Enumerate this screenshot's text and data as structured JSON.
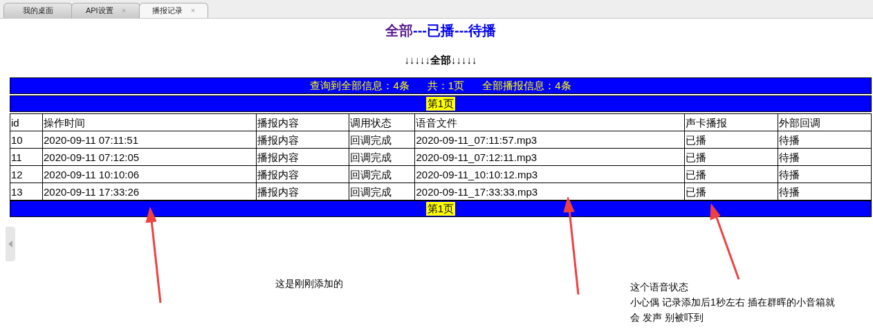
{
  "tabs": [
    {
      "label": "我的桌面",
      "selected": false,
      "closable": false
    },
    {
      "label": "API设置",
      "selected": false,
      "closable": true
    },
    {
      "label": "播报记录",
      "selected": true,
      "closable": true
    }
  ],
  "close_glyph": "×",
  "filter_links": [
    {
      "label": "全部",
      "visited": true
    },
    {
      "label": "已播",
      "visited": false
    },
    {
      "label": "待播",
      "visited": false
    }
  ],
  "separator": "---",
  "current_filter": "↓↓↓↓↓**全部**↓↓↓↓↓",
  "summary": [
    "查询到全部信息：4条",
    "共：1页",
    "全部播报信息：4条"
  ],
  "page_top": "第1页",
  "table": {
    "columns": [
      "id",
      "操作时间",
      "播报内容",
      "调用状态",
      "语音文件",
      "声卡播报",
      "外部回调"
    ],
    "rows": [
      [
        "10",
        "2020-09-11 07:11:51",
        "播报内容",
        "回调完成",
        "2020-09-11_07:11:57.mp3",
        "已播",
        "待播"
      ],
      [
        "11",
        "2020-09-11 07:12:05",
        "播报内容",
        "回调完成",
        "2020-09-11_07:12:11.mp3",
        "已播",
        "待播"
      ],
      [
        "12",
        "2020-09-11 10:10:06",
        "播报内容",
        "回调完成",
        "2020-09-11_10:10:12.mp3",
        "已播",
        "待播"
      ],
      [
        "13",
        "2020-09-11 17:33:26",
        "播报内容",
        "回调完成",
        "2020-09-11_17:33:33.mp3",
        "已播",
        "待播"
      ]
    ]
  },
  "page_bottom": "第1页",
  "annotations": [
    {
      "lines": [
        "这是刚刚添加的"
      ]
    },
    {
      "lines": [
        "这个语音状态",
        "小心偶 记录添加后1秒左右 插在群晖的小音箱就",
        "会 发声 别被吓到"
      ]
    }
  ]
}
